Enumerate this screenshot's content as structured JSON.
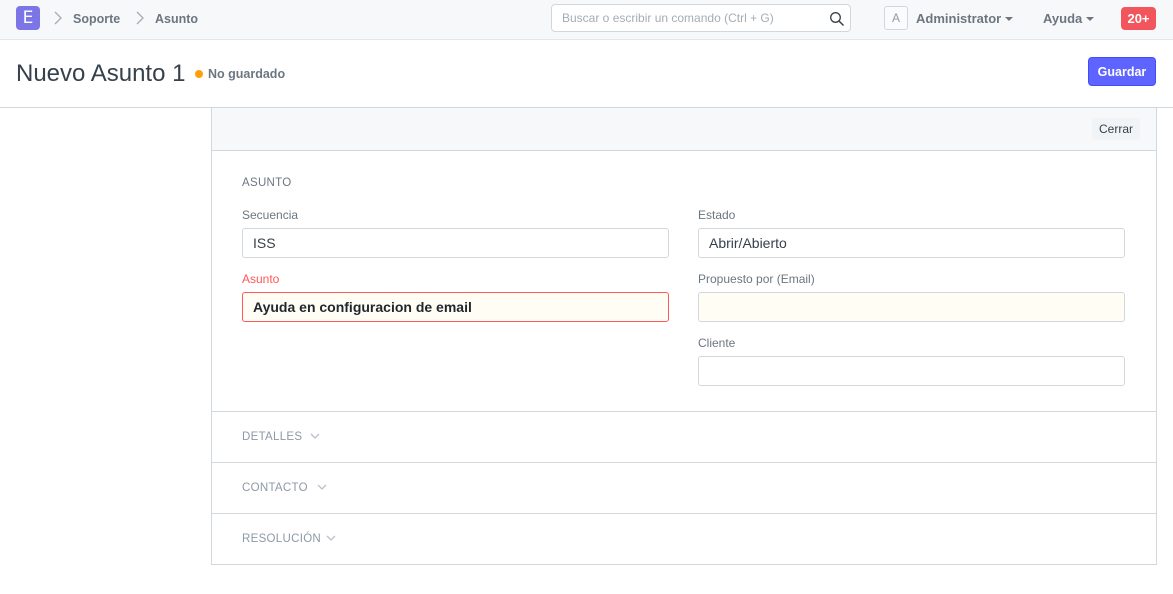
{
  "navbar": {
    "logo_letter": "E",
    "breadcrumbs": [
      "Soporte",
      "Asunto"
    ],
    "search_placeholder": "Buscar o escribir un comando (Ctrl + G)",
    "avatar_initial": "A",
    "user_label": "Administrator",
    "help_label": "Ayuda",
    "notifications": "20+"
  },
  "page": {
    "title": "Nuevo Asunto 1",
    "status": "No guardado",
    "status_color": "#ffa00a",
    "save_label": "Guardar",
    "close_label": "Cerrar"
  },
  "form": {
    "section_title": "ASUNTO",
    "fields": {
      "sequence": {
        "label": "Secuencia",
        "value": "ISS"
      },
      "subject": {
        "label": "Asunto",
        "value": "Ayuda en configuracion de email"
      },
      "status": {
        "label": "Estado",
        "value": "Abrir/Abierto"
      },
      "raised_by": {
        "label": "Propuesto por (Email)",
        "value": ""
      },
      "customer": {
        "label": "Cliente",
        "value": ""
      }
    },
    "collapsed_sections": [
      "DETALLES",
      "CONTACTO",
      "RESOLUCIÓN"
    ]
  },
  "colors": {
    "primary": "#5e64ff",
    "error": "#ff5858",
    "badge": "#f2555c",
    "logo": "#7c75e6"
  }
}
